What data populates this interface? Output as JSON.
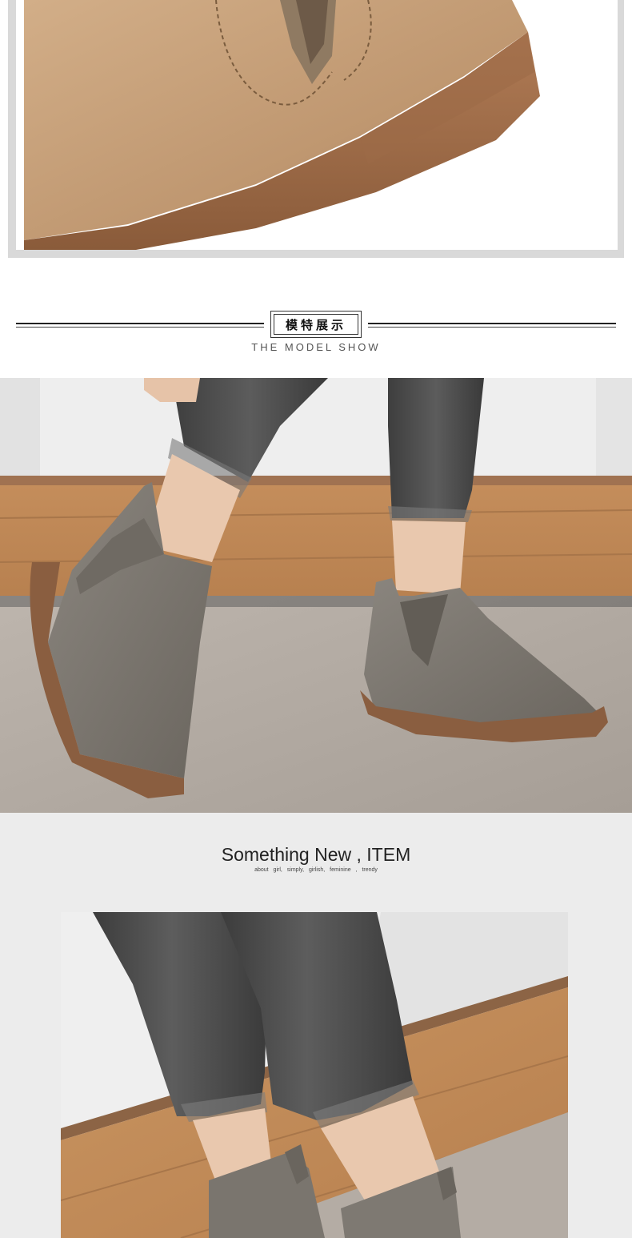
{
  "section_header": {
    "title_cn": "模特展示",
    "subtitle": "THE MODEL SHOW"
  },
  "slogan": {
    "title": "Something New , ITEM",
    "tags": "about girl,  simply,  girlish,  feminine ,  trendy"
  },
  "colors": {
    "boot_tan": "#c8a27c",
    "boot_grey": "#7b766f",
    "sole_brown": "#8a5e40",
    "jeans_grey": "#4a4a4a",
    "floor_wood": "#c7925f",
    "rug": "#b4aca4",
    "wall": "#f0f0f0"
  }
}
